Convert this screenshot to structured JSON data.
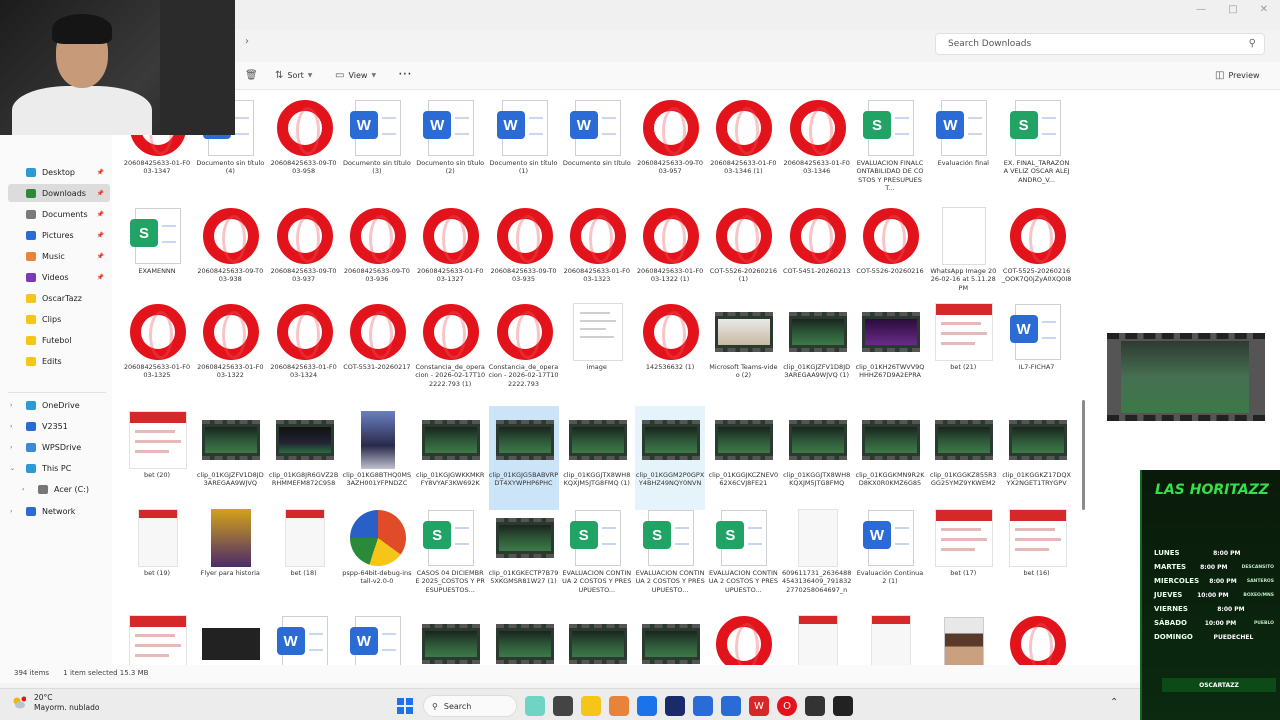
{
  "explorer": {
    "search_placeholder": "Search Downloads",
    "toolbar": {
      "sort": "Sort",
      "view": "View",
      "more": "⋯",
      "preview": "Preview"
    },
    "status": {
      "count": "394 items",
      "selected": "1 item selected  15.3 MB"
    }
  },
  "nav": {
    "quick": [
      "Desktop",
      "Downloads",
      "Documents",
      "Pictures",
      "Music",
      "Videos",
      "OscarTazz",
      "Clips",
      "Futebol",
      "Edits"
    ],
    "tree": [
      "OneDrive",
      "V2351",
      "WPSDrive",
      "This PC",
      "Acer (C:)",
      "Network"
    ]
  },
  "files": [
    {
      "n": "20608425633-01-F003-1347",
      "t": "opera"
    },
    {
      "n": "Documento sin título (4)",
      "t": "word"
    },
    {
      "n": "20608425633-09-T003-958",
      "t": "opera"
    },
    {
      "n": "Documento sin título (3)",
      "t": "word"
    },
    {
      "n": "Documento sin título (2)",
      "t": "word"
    },
    {
      "n": "Documento sin título (1)",
      "t": "word"
    },
    {
      "n": "Documento sin título",
      "t": "word"
    },
    {
      "n": "20608425633-09-T003-957",
      "t": "opera"
    },
    {
      "n": "20608425633-01-F003-1346 (1)",
      "t": "opera"
    },
    {
      "n": "20608425633-01-F003-1346",
      "t": "opera"
    },
    {
      "n": "EVALUACION FINALCONTABILIDAD DE COSTOS Y PRESUPUEST...",
      "t": "sheet"
    },
    {
      "n": "Evaluación final",
      "t": "word"
    },
    {
      "n": "EX. FINAL_TARAZONA VELIZ OSCAR ALEJANDRO_V...",
      "t": "sheet"
    },
    {
      "n": "EXAMENNN",
      "t": "sheet"
    },
    {
      "n": "20608425633-09-T003-938",
      "t": "opera"
    },
    {
      "n": "20608425633-09-T003-937",
      "t": "opera"
    },
    {
      "n": "20608425633-09-T003-936",
      "t": "opera"
    },
    {
      "n": "20608425633-01-F003-1327",
      "t": "opera"
    },
    {
      "n": "20608425633-09-T003-935",
      "t": "opera"
    },
    {
      "n": "20608425633-01-F003-1323",
      "t": "opera"
    },
    {
      "n": "20608425633-01-F003-1322 (1)",
      "t": "opera"
    },
    {
      "n": "COT-5526-20260216 (1)",
      "t": "opera"
    },
    {
      "n": "COT-5451-20260213",
      "t": "opera"
    },
    {
      "n": "COT-5526-20260216",
      "t": "opera"
    },
    {
      "n": "WhatsApp Image 2026-02-16 at 5.11.28 PM",
      "t": "wa"
    },
    {
      "n": "COT-5525-20260216_OOK7Q0jZyA0XQ0I8",
      "t": "opera"
    },
    {
      "n": "20608425633-01-F003-1325",
      "t": "opera"
    },
    {
      "n": "20608425633-01-F003-1322",
      "t": "opera"
    },
    {
      "n": "20608425633-01-F003-1324",
      "t": "opera"
    },
    {
      "n": "COT-5531-20260217",
      "t": "opera"
    },
    {
      "n": "Constancia_de_operacion - 2026-02-17T102222.793 (1)",
      "t": "opera"
    },
    {
      "n": "Constancia_de_operacion - 2026-02-17T102222.793",
      "t": "opera"
    },
    {
      "n": "image",
      "t": "img"
    },
    {
      "n": "142536632 (1)",
      "t": "opera"
    },
    {
      "n": "Microsoft Teams-video (2)",
      "t": "vperson"
    },
    {
      "n": "clip_01KGJZFV1D8JD3AREGAA9WJVQ (1)",
      "t": "video"
    },
    {
      "n": "clip_01KH26TWVV9QHHHZ67D9A2EPRA",
      "t": "vpurple"
    },
    {
      "n": "bet (21)",
      "t": "betano"
    },
    {
      "n": "IL7-FICHA7",
      "t": "word"
    },
    {
      "n": "bet (20)",
      "t": "betano"
    },
    {
      "n": "clip_01KGJZFV1D8JD3AREGAA9WJVQ",
      "t": "video"
    },
    {
      "n": "clip_01KG8JR6GVZ2BRHMMEFM872C958",
      "t": "vdark"
    },
    {
      "n": "clip_01KG8BTHQ0MS3AZH001YFPNDZC",
      "t": "poster"
    },
    {
      "n": "clip_01KGJGWKKMKRFY8VYAF3KW692K",
      "t": "video"
    },
    {
      "n": "clip_01KGJG5BABVRPDT4XYWPHP6PHC",
      "t": "video",
      "s": "sel"
    },
    {
      "n": "clip_01KGGJTX8WH8KQXJM5JTG8FMQ (1)",
      "t": "video"
    },
    {
      "n": "clip_01KGGM2P0GPXY4BHZ49NQY0NVN",
      "t": "video",
      "s": "hover"
    },
    {
      "n": "clip_01KGGJKCZNEV062X6CVJ8FE21",
      "t": "video"
    },
    {
      "n": "clip_01KGGJTX8WH8KQXJM5JTG8FMQ",
      "t": "video"
    },
    {
      "n": "clip_01KGGKMN9R2KD8KX0R0KMZ6G85",
      "t": "video"
    },
    {
      "n": "clip_01KGGKZ855R3GG25YMZ9YKWEM2",
      "t": "video"
    },
    {
      "n": "clip_01KGGKZ17DQXYX2NGET1TRYGPV",
      "t": "video"
    },
    {
      "n": "bet (19)",
      "t": "tall"
    },
    {
      "n": "Flyer para historia",
      "t": "flyer"
    },
    {
      "n": "bet (18)",
      "t": "tall"
    },
    {
      "n": "pspp-64bit-debug-install-v2.0-0",
      "t": "pie"
    },
    {
      "n": "CASOS 04 DICIEMBRE 2025_COSTOS Y PRESUPUESTOS...",
      "t": "sheet"
    },
    {
      "n": "clip_01KGKECTP7B795XKGMSR81W27 (1)",
      "t": "video"
    },
    {
      "n": "EVALUACION CONTINUA 2 COSTOS Y PRESUPUESTO...",
      "t": "sheet"
    },
    {
      "n": "EVALUACION CONTINUA 2 COSTOS Y PRESUPUESTO...",
      "t": "sheet"
    },
    {
      "n": "EVALUACION CONTINUA 2 COSTOS Y PRESUPUESTO...",
      "t": "sheet"
    },
    {
      "n": "609611731_26364884543136409_7918322770258064697_n",
      "t": "blank"
    },
    {
      "n": "Evaluación Continua 2 (1)",
      "t": "word"
    },
    {
      "n": "bet (17)",
      "t": "betano"
    },
    {
      "n": "bet (16)",
      "t": "betano"
    },
    {
      "n": "",
      "t": "betano"
    },
    {
      "n": "",
      "t": "tudark"
    },
    {
      "n": "",
      "t": "word"
    },
    {
      "n": "",
      "t": "word"
    },
    {
      "n": "",
      "t": "video"
    },
    {
      "n": "",
      "t": "video"
    },
    {
      "n": "",
      "t": "video"
    },
    {
      "n": "",
      "t": "video"
    },
    {
      "n": "",
      "t": "opera"
    },
    {
      "n": "",
      "t": "tall"
    },
    {
      "n": "",
      "t": "tall"
    },
    {
      "n": "",
      "t": "photo"
    },
    {
      "n": "",
      "t": "opera"
    }
  ],
  "taskbar": {
    "weather_temp": "20°C",
    "weather_desc": "Mayorm. nublado",
    "search_label": "Search"
  },
  "banner": {
    "title": "LAS HORITAZZ",
    "handle": "OSCARTAZZ",
    "schedule": [
      {
        "day": "LUNES",
        "time": "8:00 PM",
        "note": ""
      },
      {
        "day": "MARTES",
        "time": "8:00 PM",
        "note": "DESCANSITO"
      },
      {
        "day": "MIERCOLES",
        "time": "8:00 PM",
        "note": "SANTEROS"
      },
      {
        "day": "JUEVES",
        "time": "10:00 PM",
        "note": "BOXEO/MNS"
      },
      {
        "day": "VIERNES",
        "time": "8:00 PM",
        "note": ""
      },
      {
        "day": "SÁBADO",
        "time": "10:00 PM",
        "note": "PUEBLO"
      },
      {
        "day": "DOMINGO",
        "time": "PUEDECHEL",
        "note": ""
      }
    ]
  },
  "colors": {
    "opera": "#e3131b",
    "word": "#2b6bd6",
    "sheet": "#21a366",
    "selection": "#cce4f7"
  }
}
